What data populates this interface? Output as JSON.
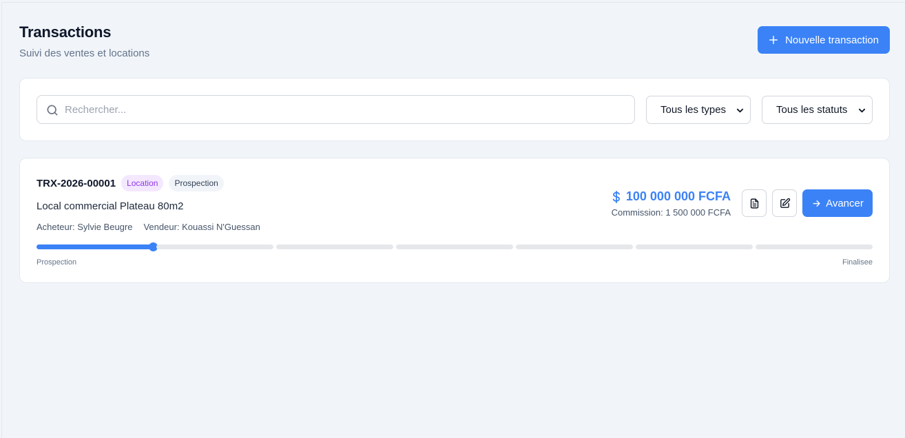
{
  "header": {
    "title": "Transactions",
    "subtitle": "Suivi des ventes et locations",
    "new_button_label": "Nouvelle transaction"
  },
  "filters": {
    "search_placeholder": "Rechercher...",
    "type_select": "Tous les types",
    "status_select": "Tous les statuts"
  },
  "transaction": {
    "reference": "TRX-2026-00001",
    "type_badge": "Location",
    "status_badge": "Prospection",
    "property": "Local commercial Plateau 80m2",
    "buyer": "Acheteur: Sylvie Beugre",
    "seller": "Vendeur: Kouassi N'Guessan",
    "amount": "100 000 000 FCFA",
    "commission": "Commission: 1 500 000 FCFA",
    "advance_label": "Avancer",
    "progress": {
      "total_stages": 7,
      "current_stage": 1,
      "start_label": "Prospection",
      "end_label": "Finalisee"
    }
  },
  "colors": {
    "accent": "#3b82f6",
    "type_badge_bg": "#f3e8ff",
    "type_badge_text": "#9333ea"
  }
}
